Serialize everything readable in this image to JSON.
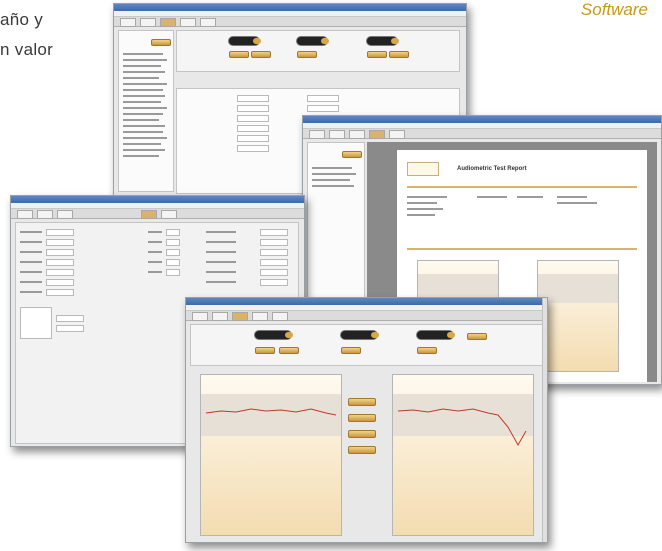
{
  "intro_text": {
    "line1": "año  y",
    "line2": "n  valor"
  },
  "brand": {
    "software_label": "Software"
  },
  "report": {
    "title": "Audiometric Test Report"
  },
  "colors": {
    "accent_gold": "#c79a12",
    "titlebar_blue": "#3d6aa8",
    "panel_peach": "#f3dcb0",
    "button_gold": "#d8a845"
  },
  "screens": [
    {
      "name": "screen-patient-session"
    },
    {
      "name": "screen-settings"
    },
    {
      "name": "screen-report-preview"
    },
    {
      "name": "screen-audiogram"
    }
  ]
}
